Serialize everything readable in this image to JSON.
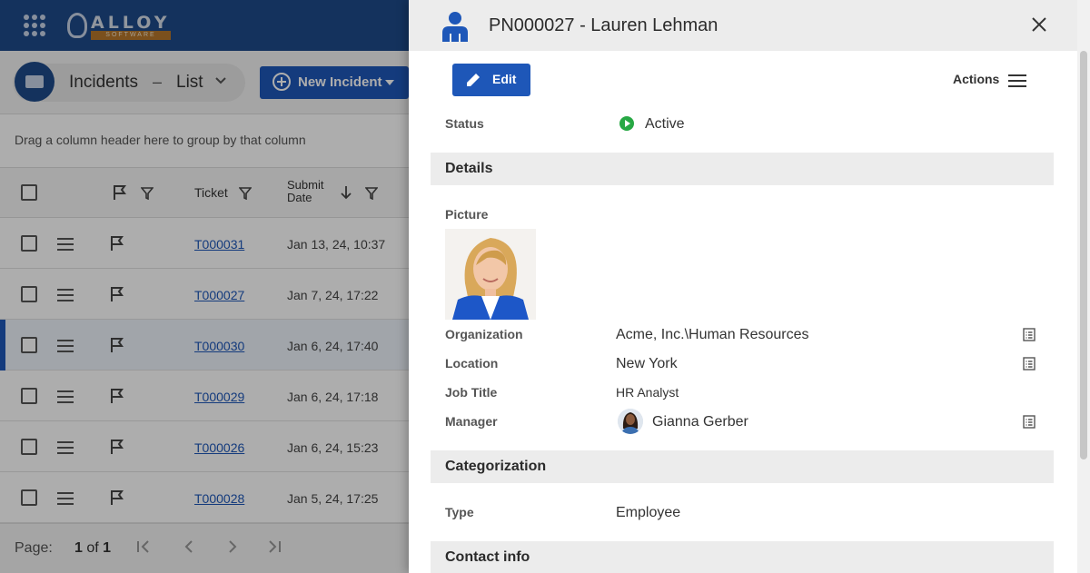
{
  "app": {
    "logo_text": "ALLOY",
    "logo_subtext": "SOFTWARE",
    "breadcrumb_title": "Incidents",
    "breadcrumb_separator": "–",
    "breadcrumb_view": "List",
    "new_button_label": "New Incident"
  },
  "grid": {
    "group_hint": "Drag a column header here to group by that column",
    "columns": {
      "ticket": "Ticket",
      "submit_date_line1": "Submit",
      "submit_date_line2": "Date"
    },
    "rows": [
      {
        "ticket": "T000031",
        "submit_date": "Jan 13, 24, 10:37"
      },
      {
        "ticket": "T000027",
        "submit_date": "Jan 7, 24, 17:22"
      },
      {
        "ticket": "T000030",
        "submit_date": "Jan 6, 24, 17:40"
      },
      {
        "ticket": "T000029",
        "submit_date": "Jan 6, 24, 17:18"
      },
      {
        "ticket": "T000026",
        "submit_date": "Jan 6, 24, 15:23"
      },
      {
        "ticket": "T000028",
        "submit_date": "Jan 5, 24, 17:25"
      }
    ],
    "pager": {
      "label": "Page:",
      "current": "1",
      "of_text": "of",
      "total": "1"
    }
  },
  "panel": {
    "title": "PN000027 - Lauren Lehman",
    "edit_label": "Edit",
    "actions_label": "Actions",
    "status": {
      "label": "Status",
      "value": "Active"
    },
    "sections": {
      "details": "Details",
      "categorization": "Categorization",
      "contact_info": "Contact info"
    },
    "details": {
      "picture_label": "Picture",
      "organization_label": "Organization",
      "organization_value": "Acme, Inc.\\Human Resources",
      "location_label": "Location",
      "location_value": "New York",
      "job_title_label": "Job Title",
      "job_title_value": "HR Analyst",
      "manager_label": "Manager",
      "manager_value": "Gianna Gerber"
    },
    "categorization": {
      "type_label": "Type",
      "type_value": "Employee"
    }
  },
  "colors": {
    "brand": "#1e4a8a",
    "accent": "#1e57b8",
    "status_active": "#27a844"
  }
}
